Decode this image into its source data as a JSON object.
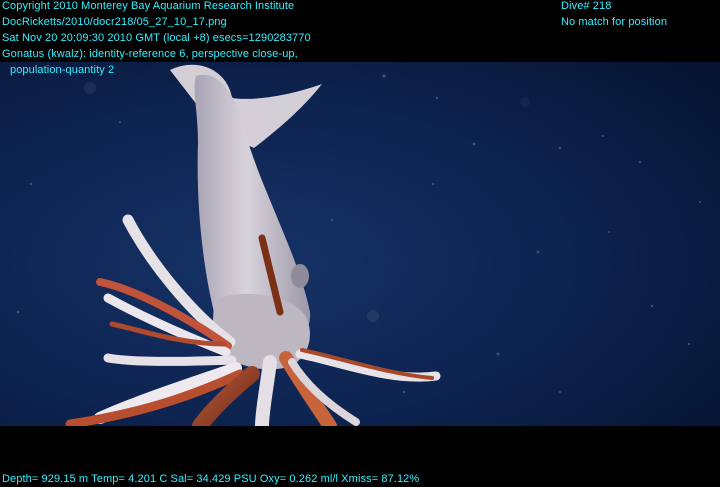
{
  "overlay": {
    "copyright": "Copyright 2010 Monterey Bay Aquarium Research Institute",
    "file": "DocRicketts/2010/docr218/05_27_10_17.png",
    "datetime": "Sat Nov 20 20:09:30 2010 GMT (local +8)  esecs=1290283770",
    "annotation_line1": "Gonatus (kwalz): identity-reference 6, perspective close-up,",
    "annotation_line2": "population-quantity 2",
    "dive": "Dive# 218",
    "position": "No match for position",
    "sensors": "Depth= 929.15 m  Temp= 4.201 C  Sal= 34.429 PSU  Oxy= 0.262 ml/l  Xmiss= 87.12%"
  },
  "colors": {
    "overlay_text": "#33f0ff",
    "water": "#0b1f45",
    "squid_body": "#c9c3cc",
    "arm_red": "#9a3f1f"
  }
}
